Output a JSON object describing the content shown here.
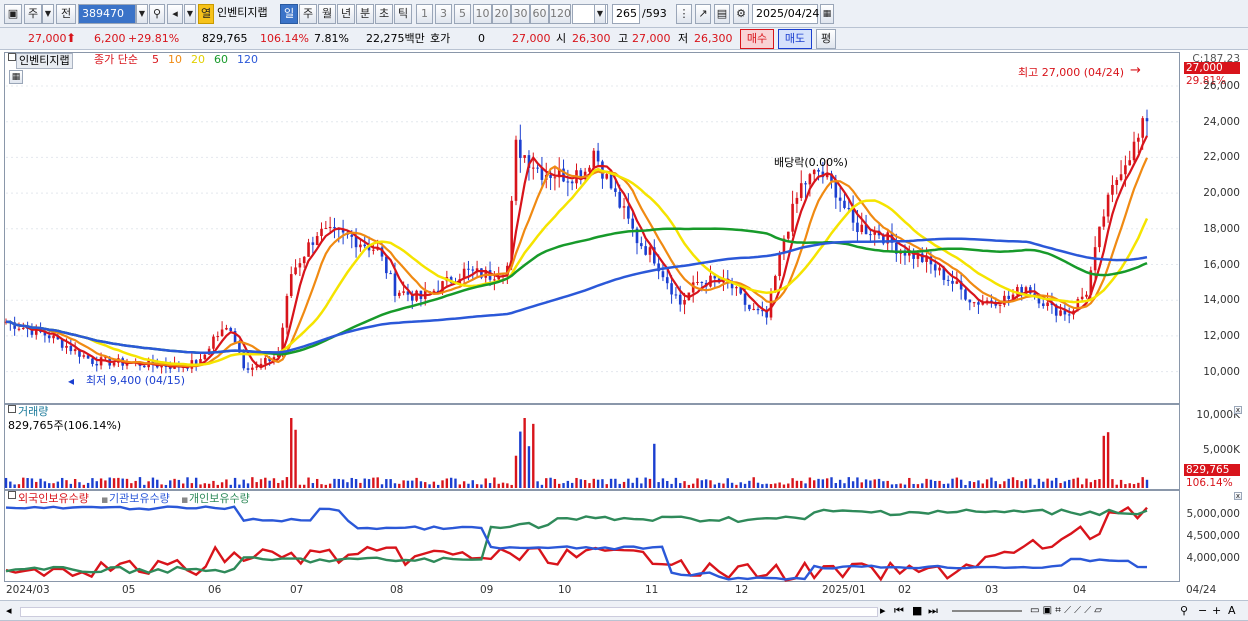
{
  "toolbar": {
    "market": "주",
    "prev": "전",
    "code": "389470",
    "open_badge": "열",
    "name": "인벤티지랩",
    "periods": [
      "일",
      "주",
      "월",
      "년",
      "분",
      "초",
      "틱"
    ],
    "period_selected": "일",
    "intervals": [
      "1",
      "3",
      "5",
      "10",
      "20",
      "30",
      "60",
      "120"
    ],
    "count": "265",
    "total": "/593",
    "date": "2025/04/24"
  },
  "quote": {
    "price": "27,000",
    "change": "6,200",
    "change_pct": "+29.81%",
    "volume": "829,765",
    "vol_ratio": "106.14%",
    "turnover": "7.81%",
    "amount": "22,275백만",
    "hoga_label": "호가",
    "hoga": "0",
    "price2": "27,000",
    "open_label": "시",
    "open": "26,300",
    "high_label": "고",
    "high": "27,000",
    "low_label": "저",
    "low": "26,300",
    "buy": "매수",
    "sell": "매도",
    "avg": "평"
  },
  "price_panel": {
    "name_tag": "인벤티지랩",
    "legend_prefix": "종가 단순",
    "ma_legend": [
      {
        "label": "5",
        "color": "#d8141b"
      },
      {
        "label": "10",
        "color": "#f08a12"
      },
      {
        "label": "20",
        "color": "#f5e400"
      },
      {
        "label": "60",
        "color": "#179a2a"
      },
      {
        "label": "120",
        "color": "#2b58d8"
      }
    ],
    "high_annotation": "최고 27,000 (04/24)",
    "low_annotation": "최저 9,400 (04/15)",
    "dividend_annotation": "배당락(0.00%)",
    "y_top": "C:187.23",
    "cur_price_tag": "27,000",
    "cur_pct_tag": "29.81%",
    "y_labels": [
      "26,000",
      "24,000",
      "22,000",
      "20,000",
      "18,000",
      "16,000",
      "14,000",
      "12,000",
      "10,000"
    ]
  },
  "volume_panel": {
    "title": "거래량",
    "value": "829,765주(106.14%)",
    "y_labels": [
      "10,000K",
      "5,000K"
    ],
    "tag_value": "829,765",
    "tag_pct": "106.14%"
  },
  "holding_panel": {
    "legend": [
      {
        "label": "외국인보유수량",
        "color": "#d8141b"
      },
      {
        "label": "기관보유수량",
        "color": "#2b58d8"
      },
      {
        "label": "개인보유수량",
        "color": "#2f8a5a"
      }
    ],
    "y_labels": [
      "5,000,000",
      "4,500,000",
      "4,000,000"
    ]
  },
  "x_labels": [
    "2024/03",
    "05",
    "06",
    "07",
    "08",
    "09",
    "10",
    "11",
    "12",
    "2025/01",
    "02",
    "03",
    "04",
    "04/24"
  ],
  "colors": {
    "up": "#d8141b",
    "down": "#1b3fd0",
    "accent": "#3a73c8"
  }
}
